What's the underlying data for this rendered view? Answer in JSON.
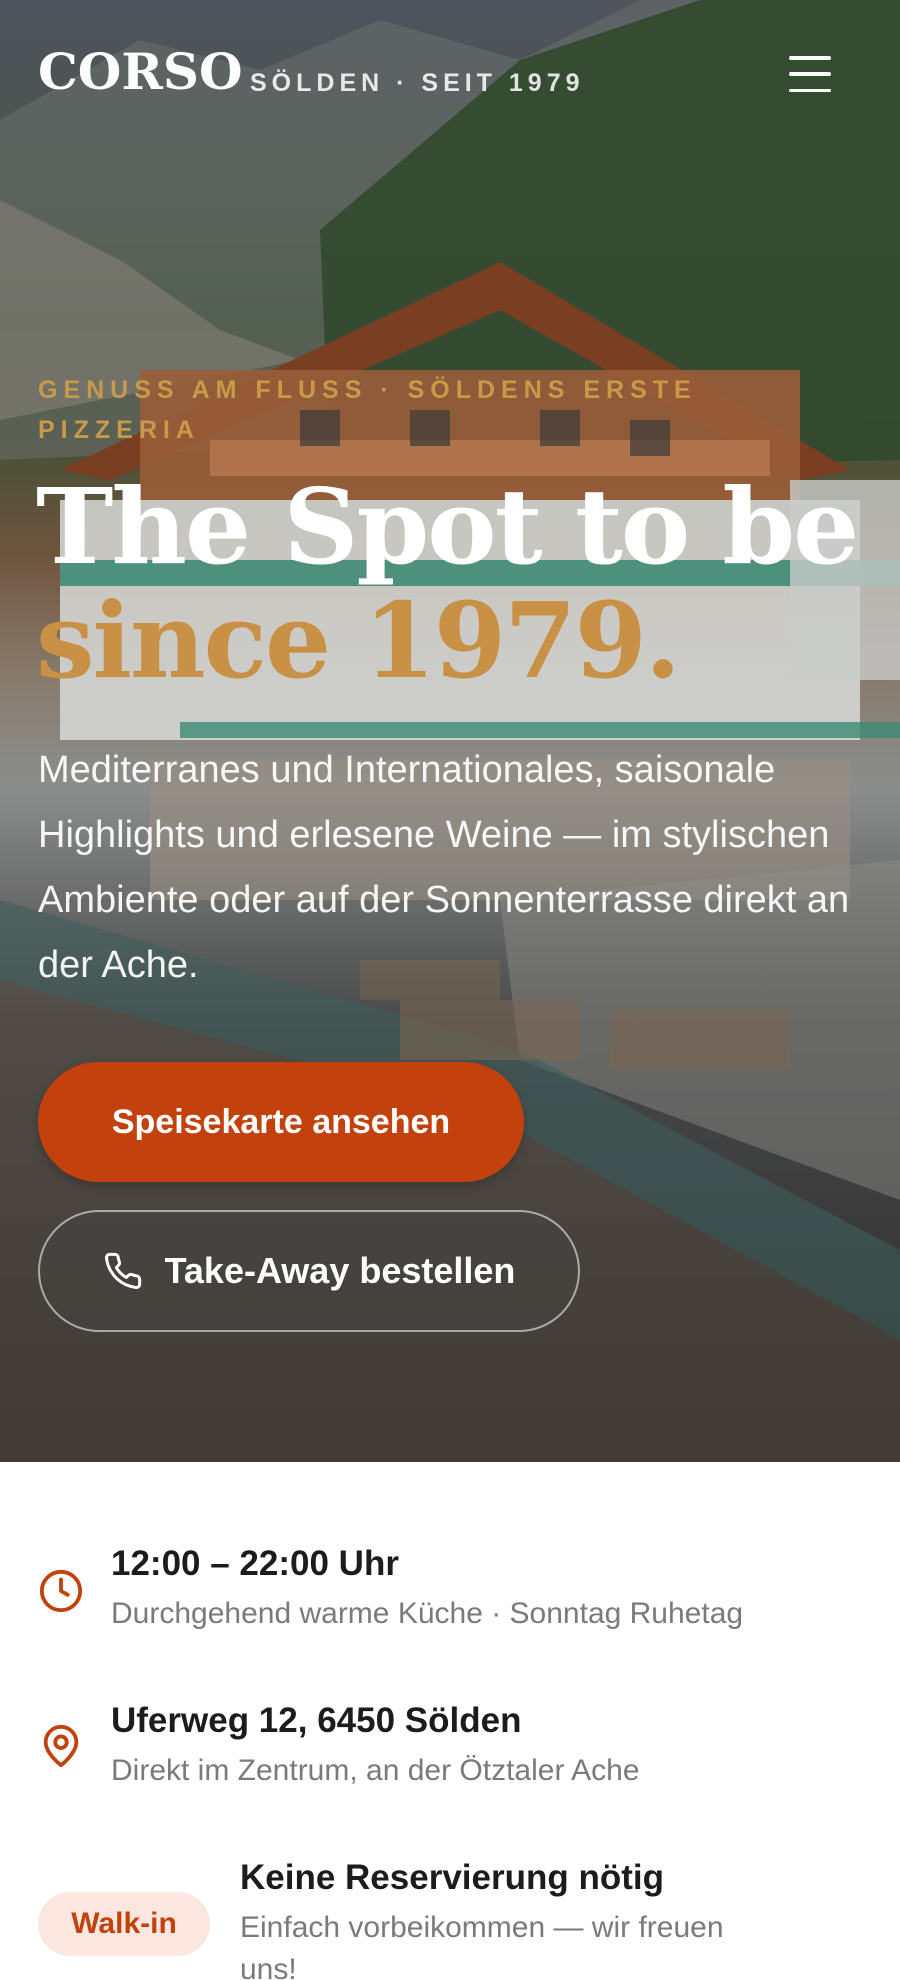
{
  "header": {
    "logo": "CORSO",
    "tagline": "SÖLDEN · SEIT 1979"
  },
  "hero": {
    "eyebrow": "GENUSS AM FLUSS · SÖLDENS ERSTE PIZZERIA",
    "headline_line1": "The Spot to be",
    "headline_line2": "since 1979.",
    "lead": "Mediterranes und Internationales, saisonale Highlights und erlesene Weine — im stylischen Ambiente oder auf der Sonnenterrasse direkt an der Ache.",
    "primary_cta": "Speisekarte ansehen",
    "secondary_cta": "Take-Away bestellen"
  },
  "info": {
    "hours_title": "12:00 – 22:00 Uhr",
    "hours_sub": "Durchgehend warme Küche · Sonntag Ruhetag",
    "address_title": "Uferweg 12, 6450 Sölden",
    "address_sub": "Direkt im Zentrum, an der Ötztaler Ache",
    "walkin_badge": "Walk-in",
    "walkin_title": "Keine Reservierung nötig",
    "walkin_sub_line1": "Einfach vorbeikommen — wir freuen",
    "walkin_sub_line2": "uns!"
  },
  "colors": {
    "accent": "#c2410c",
    "gold": "#c99146",
    "badge_bg": "#fbe7df",
    "muted_text": "#7a7a7a"
  },
  "icons": {
    "menu": "hamburger-menu-icon",
    "phone": "phone-icon",
    "clock": "clock-icon",
    "location": "map-pin-icon"
  }
}
